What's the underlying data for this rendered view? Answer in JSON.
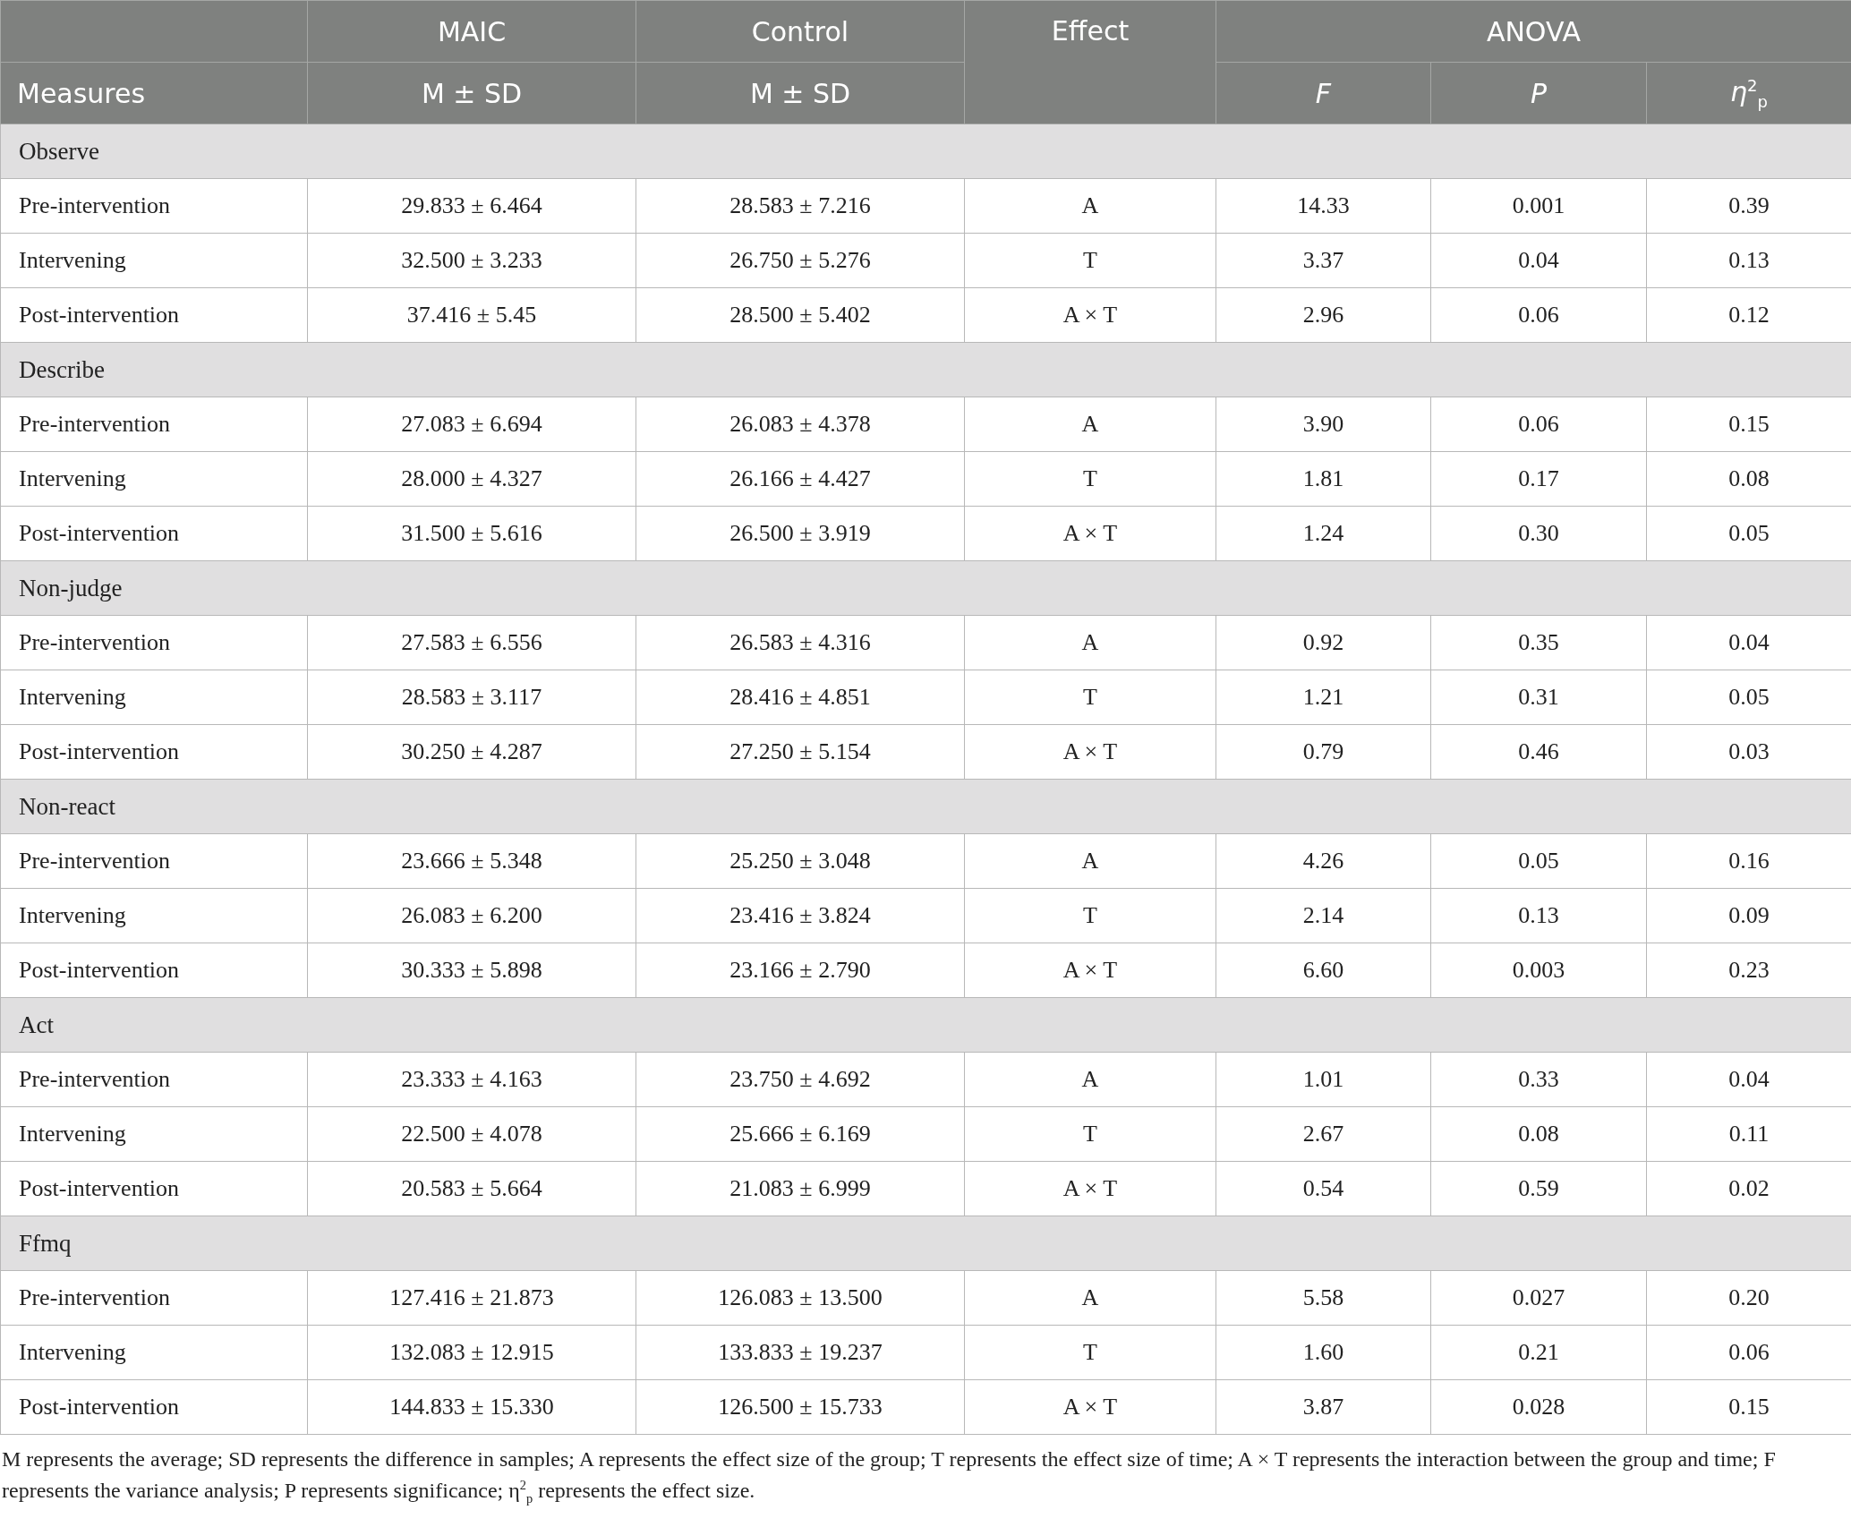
{
  "table": {
    "group_headers": [
      "MAIC",
      "Control",
      "Effect",
      "ANOVA"
    ],
    "column_headers": [
      {
        "text": "Measures",
        "italic": false
      },
      {
        "text": "M ± SD",
        "italic": false
      },
      {
        "text": "M ± SD",
        "italic": false
      },
      {
        "text": "F",
        "italic": true
      },
      {
        "text": "P",
        "italic": true
      },
      {
        "text": "*η*$^{2}$$_{p}$",
        "italic": false
      }
    ],
    "sections": [
      {
        "name": "Observe",
        "rows": [
          [
            "Pre-intervention",
            "29.833 ± 6.464",
            "28.583 ± 7.216",
            "A",
            "14.33",
            "0.001",
            "0.39"
          ],
          [
            "Intervening",
            "32.500 ± 3.233",
            "26.750 ± 5.276",
            "T",
            "3.37",
            "0.04",
            "0.13"
          ],
          [
            "Post-intervention",
            "37.416 ± 5.45",
            "28.500 ± 5.402",
            "A × T",
            "2.96",
            "0.06",
            "0.12"
          ]
        ]
      },
      {
        "name": "Describe",
        "rows": [
          [
            "Pre-intervention",
            "27.083 ± 6.694",
            "26.083 ± 4.378",
            "A",
            "3.90",
            "0.06",
            "0.15"
          ],
          [
            "Intervening",
            "28.000 ± 4.327",
            "26.166 ± 4.427",
            "T",
            "1.81",
            "0.17",
            "0.08"
          ],
          [
            "Post-intervention",
            "31.500 ± 5.616",
            "26.500 ± 3.919",
            "A × T",
            "1.24",
            "0.30",
            "0.05"
          ]
        ]
      },
      {
        "name": "Non-judge",
        "rows": [
          [
            "Pre-intervention",
            "27.583 ± 6.556",
            "26.583 ± 4.316",
            "A",
            "0.92",
            "0.35",
            "0.04"
          ],
          [
            "Intervening",
            "28.583 ± 3.117",
            "28.416 ± 4.851",
            "T",
            "1.21",
            "0.31",
            "0.05"
          ],
          [
            "Post-intervention",
            "30.250 ± 4.287",
            "27.250 ± 5.154",
            "A × T",
            "0.79",
            "0.46",
            "0.03"
          ]
        ]
      },
      {
        "name": "Non-react",
        "rows": [
          [
            "Pre-intervention",
            "23.666 ± 5.348",
            "25.250 ± 3.048",
            "A",
            "4.26",
            "0.05",
            "0.16"
          ],
          [
            "Intervening",
            "26.083 ± 6.200",
            "23.416 ± 3.824",
            "T",
            "2.14",
            "0.13",
            "0.09"
          ],
          [
            "Post-intervention",
            "30.333 ± 5.898",
            "23.166 ± 2.790",
            "A × T",
            "6.60",
            "0.003",
            "0.23"
          ]
        ]
      },
      {
        "name": "Act",
        "rows": [
          [
            "Pre-intervention",
            "23.333 ± 4.163",
            "23.750 ± 4.692",
            "A",
            "1.01",
            "0.33",
            "0.04"
          ],
          [
            "Intervening",
            "22.500 ± 4.078",
            "25.666 ± 6.169",
            "T",
            "2.67",
            "0.08",
            "0.11"
          ],
          [
            "Post-intervention",
            "20.583 ± 5.664",
            "21.083 ± 6.999",
            "A × T",
            "0.54",
            "0.59",
            "0.02"
          ]
        ]
      },
      {
        "name": "Ffmq",
        "rows": [
          [
            "Pre-intervention",
            "127.416 ± 21.873",
            "126.083 ± 13.500",
            "A",
            "5.58",
            "0.027",
            "0.20"
          ],
          [
            "Intervening",
            "132.083 ± 12.915",
            "133.833 ± 19.237",
            "T",
            "1.60",
            "0.21",
            "0.06"
          ],
          [
            "Post-intervention",
            "144.833 ± 15.330",
            "126.500 ± 15.733",
            "A × T",
            "3.87",
            "0.028",
            "0.15"
          ]
        ]
      }
    ]
  },
  "footnote": "M represents the average; SD represents the difference in samples; A represents the effect size of the group; T represents the effect size of time; A × T represents the interaction between the group and time; F represents the variance analysis; P represents significance; η$^{2}$$_{p}$ represents the effect size."
}
